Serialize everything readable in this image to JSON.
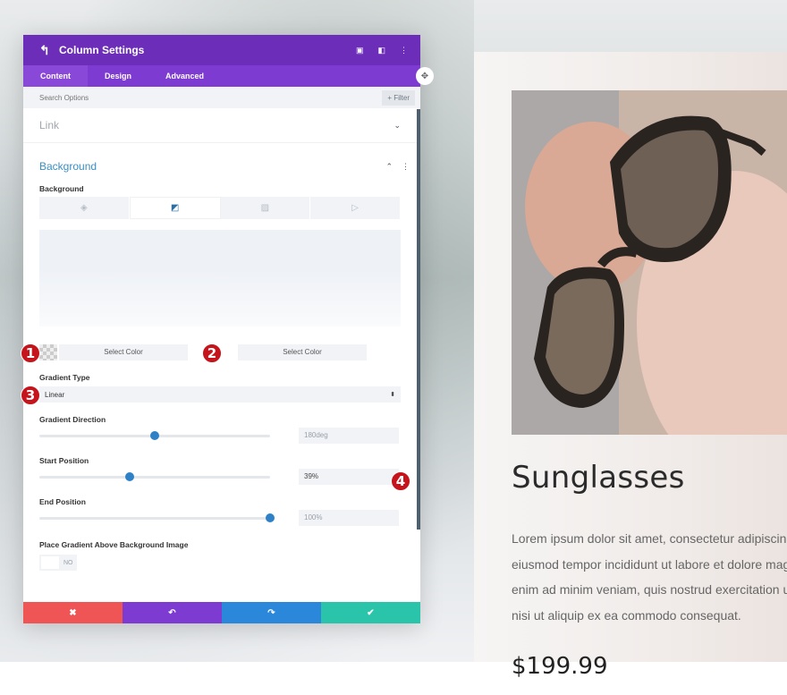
{
  "panel": {
    "title": "Column Settings",
    "header_icons": [
      "back-icon",
      "fullscreen-icon",
      "split-view-icon",
      "more-options-icon"
    ],
    "tabs": [
      {
        "label": "Content",
        "active": true
      },
      {
        "label": "Design",
        "active": false
      },
      {
        "label": "Advanced",
        "active": false
      }
    ],
    "search_placeholder": "Search Options",
    "filter_label": "+ Filter",
    "sections": {
      "link": {
        "title": "Link",
        "collapsed": true
      },
      "background": {
        "title": "Background",
        "collapsed": false
      }
    },
    "background_label": "Background",
    "background_types": [
      {
        "icon": "color-fill-icon",
        "active": false
      },
      {
        "icon": "gradient-icon",
        "active": true
      },
      {
        "icon": "image-icon",
        "active": false
      },
      {
        "icon": "video-icon",
        "active": false
      }
    ],
    "colors": {
      "start_label": "Select Color",
      "end_label": "Select Color"
    },
    "gradient_type": {
      "label": "Gradient Type",
      "value": "Linear"
    },
    "gradient_direction": {
      "label": "Gradient Direction",
      "value": "180deg",
      "slider_fraction": 0.5
    },
    "start_position": {
      "label": "Start Position",
      "value": "39%",
      "slider_fraction": 0.39
    },
    "end_position": {
      "label": "End Position",
      "value": "100%",
      "slider_fraction": 1.0
    },
    "place_above": {
      "label": "Place Gradient Above Background Image",
      "value": "NO"
    },
    "footer": {
      "cancel_icon": "✖",
      "undo_icon": "↶",
      "redo_icon": "↷",
      "save_icon": "✔"
    }
  },
  "markers": [
    "1",
    "2",
    "3",
    "4"
  ],
  "product": {
    "title": "Sunglasses",
    "description_lines": [
      "Lorem ipsum dolor sit amet, consectetur adipiscing",
      "eiusmod tempor incididunt ut labore et dolore mag",
      "enim ad minim veniam, quis nostrud exercitation ul",
      "nisi ut aliquip ex ea commodo consequat."
    ],
    "price": "$199.99"
  },
  "colors": {
    "header": "#6c2eb9",
    "tabs": "#7d3bd1",
    "accent_blue": "#2f81c7",
    "cancel": "#ef5555",
    "undo": "#7d3bd1",
    "redo": "#2b87da",
    "save": "#29c4a9",
    "marker": "#c5141b"
  }
}
